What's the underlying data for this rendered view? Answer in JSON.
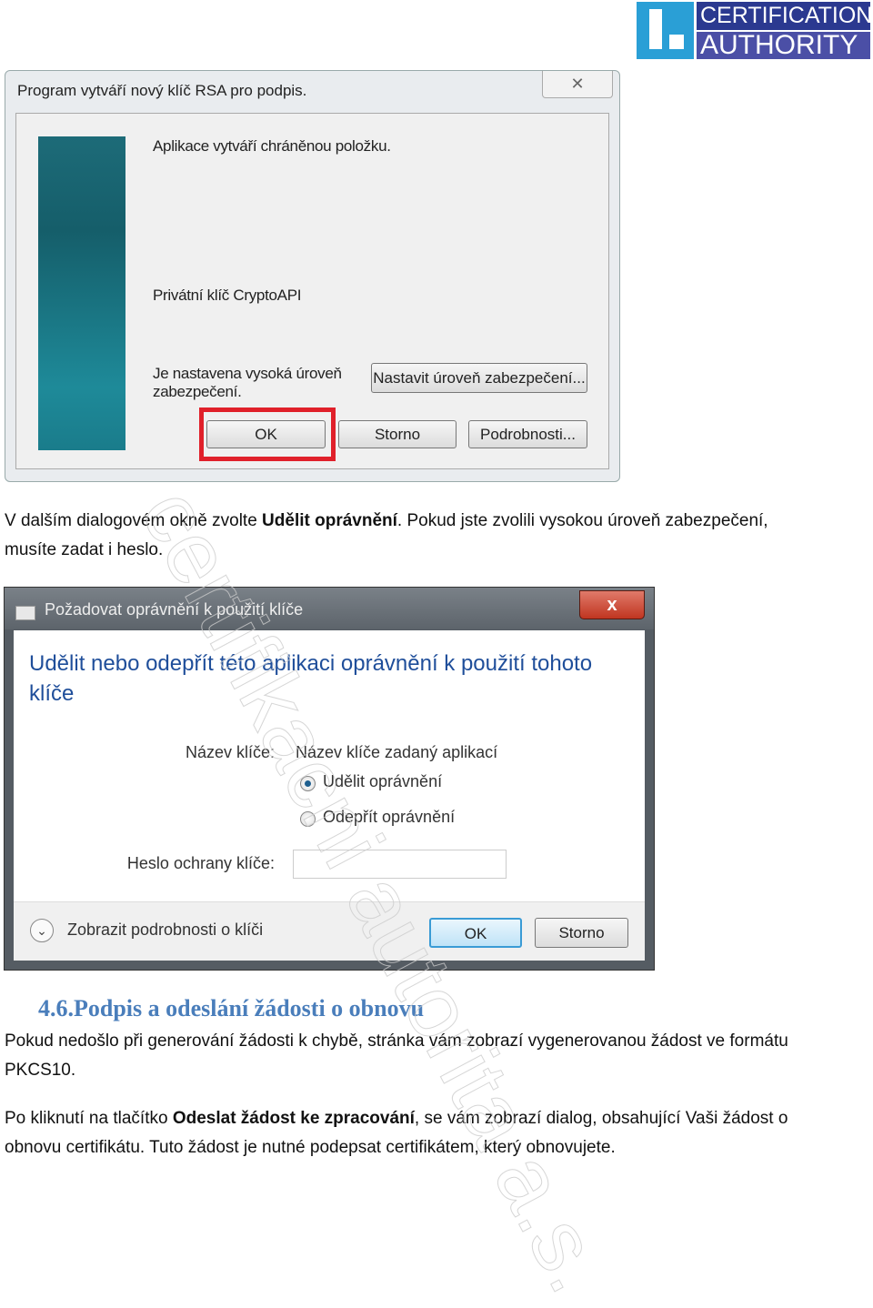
{
  "logo": {
    "line1": "CERTIFICATION",
    "line2": "AUTHORITY",
    "mark": "I.",
    "colors": {
      "square": "#2a9fd6",
      "top": "#2b3990",
      "bottom": "#4b4fa6"
    }
  },
  "watermark": "certifikacni autorita a.s.",
  "dialog1": {
    "title": "Program vytváří nový klíč RSA pro podpis.",
    "close_icon": "close-icon",
    "message": "Aplikace vytváří chráněnou položku.",
    "key_name": "Privátní klíč CryptoAPI",
    "security_line1": "Je nastavena vysoká úroveň",
    "security_line2": "zabezpečení.",
    "set_security_button": "Nastavit úroveň zabezpečení...",
    "ok_button": "OK",
    "cancel_button": "Storno",
    "details_button": "Podrobnosti...",
    "highlight_color": "#e0202a"
  },
  "para1": {
    "before": "V dalším dialogovém okně zvolte ",
    "bold": "Udělit oprávnění",
    "after": ". Pokud jste zvolili vysokou úroveň zabezpečení,",
    "line2": "musíte zadat i heslo."
  },
  "dialog2": {
    "title": "Požadovat oprávnění k použití klíče",
    "close_label": "x",
    "heading": "Udělit nebo odepřít této aplikaci oprávnění k použití tohoto klíče",
    "key_name_label": "Název klíče:",
    "key_name_value": "Název klíče zadaný aplikací",
    "radio_grant": "Udělit oprávnění",
    "radio_deny": "Odepřít oprávnění",
    "selected": "Udělit oprávnění",
    "password_label": "Heslo ochrany klíče:",
    "password_value": "",
    "details_toggle": "Zobrazit podrobnosti o klíči",
    "ok_button": "OK",
    "cancel_button": "Storno"
  },
  "section": {
    "number": "4.6.",
    "title": "Podpis a odeslání žádosti o obnovu"
  },
  "para2": {
    "line1": "Pokud nedošlo při generování žádosti k chybě, stránka vám zobrazí vygenerovanou žádost ve formátu",
    "line2": "PKCS10."
  },
  "para3": {
    "before": "Po kliknutí na tlačítko ",
    "bold": "Odeslat žádost ke zpracování",
    "after": ", se vám zobrazí dialog, obsahující Vaši žádost o",
    "line2": "obnovu certifikátu. Tuto žádost je nutné podepsat certifikátem, který obnovujete."
  }
}
